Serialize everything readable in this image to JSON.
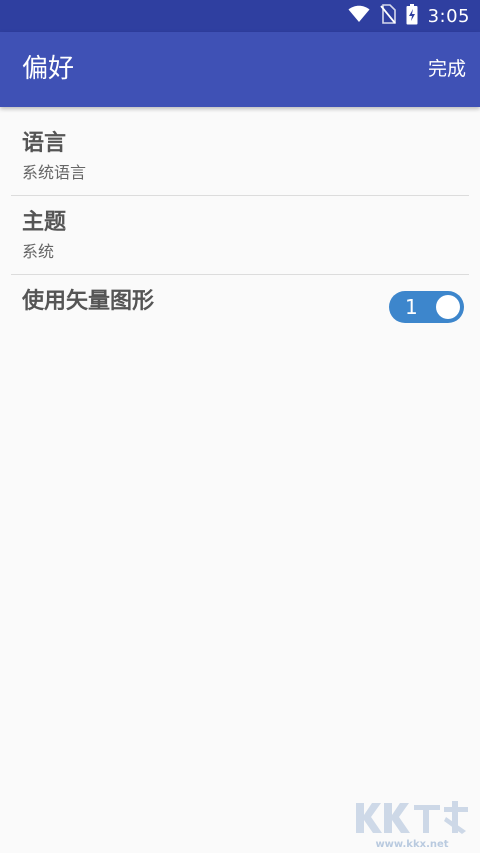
{
  "status_bar": {
    "time": "3:05",
    "icons": [
      "wifi-icon",
      "no-sim-icon",
      "battery-charging-icon"
    ]
  },
  "app_bar": {
    "title": "偏好",
    "done_label": "完成"
  },
  "preferences": [
    {
      "title": "语言",
      "summary": "系统语言"
    },
    {
      "title": "主题",
      "summary": "系统"
    },
    {
      "title": "使用矢量图形",
      "toggle_on": true,
      "toggle_text": "1"
    }
  ],
  "watermark": {
    "brand": "KK下载",
    "url": "www.kkx.net"
  },
  "colors": {
    "status_bar": "#2f3fa0",
    "app_bar": "#3f51b5",
    "toggle": "#3d86cc",
    "background": "#fafafa"
  }
}
